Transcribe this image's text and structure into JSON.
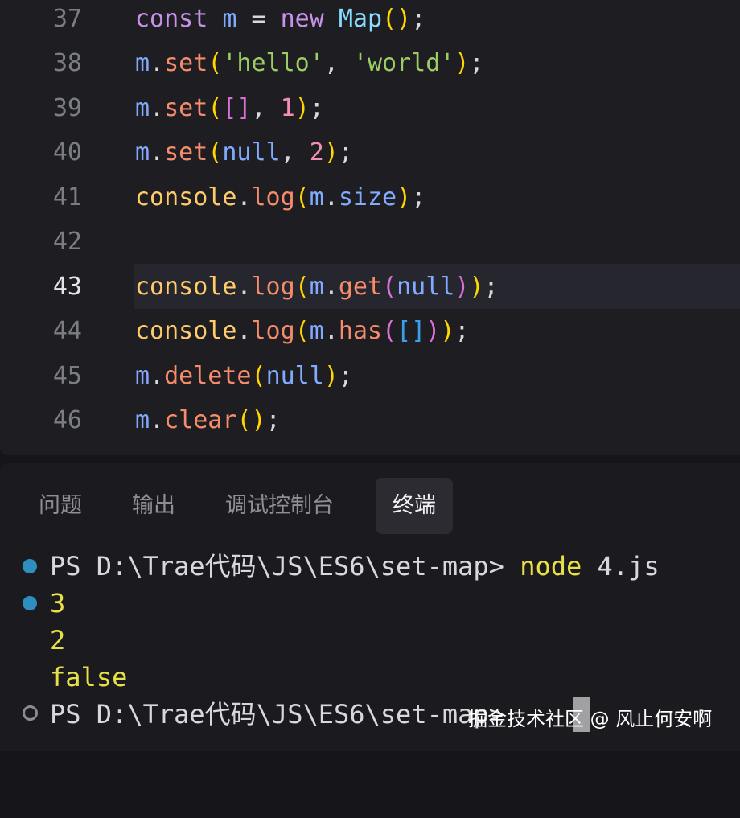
{
  "editor": {
    "lines": [
      {
        "num": "37",
        "tokens": [
          [
            "kw",
            "const"
          ],
          [
            "pn",
            " "
          ],
          [
            "var",
            "m"
          ],
          [
            "pn",
            " = "
          ],
          [
            "kw",
            "new"
          ],
          [
            "pn",
            " "
          ],
          [
            "cls",
            "Map"
          ],
          [
            "br1",
            "()"
          ],
          [
            "pn",
            ";"
          ]
        ]
      },
      {
        "num": "38",
        "tokens": [
          [
            "var",
            "m"
          ],
          [
            "pn",
            "."
          ],
          [
            "meth",
            "set"
          ],
          [
            "br1",
            "("
          ],
          [
            "str",
            "'hello'"
          ],
          [
            "pn",
            ", "
          ],
          [
            "str",
            "'world'"
          ],
          [
            "br1",
            ")"
          ],
          [
            "pn",
            ";"
          ]
        ]
      },
      {
        "num": "39",
        "tokens": [
          [
            "var",
            "m"
          ],
          [
            "pn",
            "."
          ],
          [
            "meth",
            "set"
          ],
          [
            "br1",
            "("
          ],
          [
            "br2",
            "[]"
          ],
          [
            "pn",
            ", "
          ],
          [
            "num",
            "1"
          ],
          [
            "br1",
            ")"
          ],
          [
            "pn",
            ";"
          ]
        ]
      },
      {
        "num": "40",
        "tokens": [
          [
            "var",
            "m"
          ],
          [
            "pn",
            "."
          ],
          [
            "meth",
            "set"
          ],
          [
            "br1",
            "("
          ],
          [
            "nul",
            "null"
          ],
          [
            "pn",
            ", "
          ],
          [
            "num",
            "2"
          ],
          [
            "br1",
            ")"
          ],
          [
            "pn",
            ";"
          ]
        ]
      },
      {
        "num": "41",
        "tokens": [
          [
            "fn",
            "console"
          ],
          [
            "pn",
            "."
          ],
          [
            "meth",
            "log"
          ],
          [
            "br1",
            "("
          ],
          [
            "var",
            "m"
          ],
          [
            "pn",
            "."
          ],
          [
            "var",
            "size"
          ],
          [
            "br1",
            ")"
          ],
          [
            "pn",
            ";"
          ]
        ]
      },
      {
        "num": "42",
        "tokens": []
      },
      {
        "num": "43",
        "tokens": [
          [
            "fn",
            "console"
          ],
          [
            "pn",
            "."
          ],
          [
            "meth",
            "log"
          ],
          [
            "br1",
            "("
          ],
          [
            "var",
            "m"
          ],
          [
            "pn",
            "."
          ],
          [
            "meth",
            "get"
          ],
          [
            "br2",
            "("
          ],
          [
            "nul",
            "null"
          ],
          [
            "br2",
            ")"
          ],
          [
            "br1",
            ")"
          ],
          [
            "pn",
            ";"
          ]
        ],
        "active": true
      },
      {
        "num": "44",
        "tokens": [
          [
            "fn",
            "console"
          ],
          [
            "pn",
            "."
          ],
          [
            "meth",
            "log"
          ],
          [
            "br1",
            "("
          ],
          [
            "var",
            "m"
          ],
          [
            "pn",
            "."
          ],
          [
            "meth",
            "has"
          ],
          [
            "br2",
            "("
          ],
          [
            "br3",
            "[]"
          ],
          [
            "br2",
            ")"
          ],
          [
            "br1",
            ")"
          ],
          [
            "pn",
            ";"
          ]
        ]
      },
      {
        "num": "45",
        "tokens": [
          [
            "var",
            "m"
          ],
          [
            "pn",
            "."
          ],
          [
            "meth",
            "delete"
          ],
          [
            "br1",
            "("
          ],
          [
            "nul",
            "null"
          ],
          [
            "br1",
            ")"
          ],
          [
            "pn",
            ";"
          ]
        ]
      },
      {
        "num": "46",
        "tokens": [
          [
            "var",
            "m"
          ],
          [
            "pn",
            "."
          ],
          [
            "meth",
            "clear"
          ],
          [
            "br1",
            "()"
          ],
          [
            "pn",
            ";"
          ]
        ]
      }
    ]
  },
  "panel": {
    "tabs": [
      "问题",
      "输出",
      "调试控制台",
      "终端"
    ],
    "active_tab": "终端"
  },
  "terminal": {
    "prompt1": "PS D:\\Trae代码\\JS\\ES6\\set-map> ",
    "command": "node",
    "args": " 4.js",
    "outputs": [
      "3",
      "2",
      "false"
    ],
    "prompt2": "PS D:\\Trae代码\\JS\\ES6\\set-map> "
  },
  "watermark": "掘金技术社区 @ 风止何安啊",
  "colors": {
    "dot_active": "#2e8fbf",
    "output_yellow": "#e8e047"
  }
}
